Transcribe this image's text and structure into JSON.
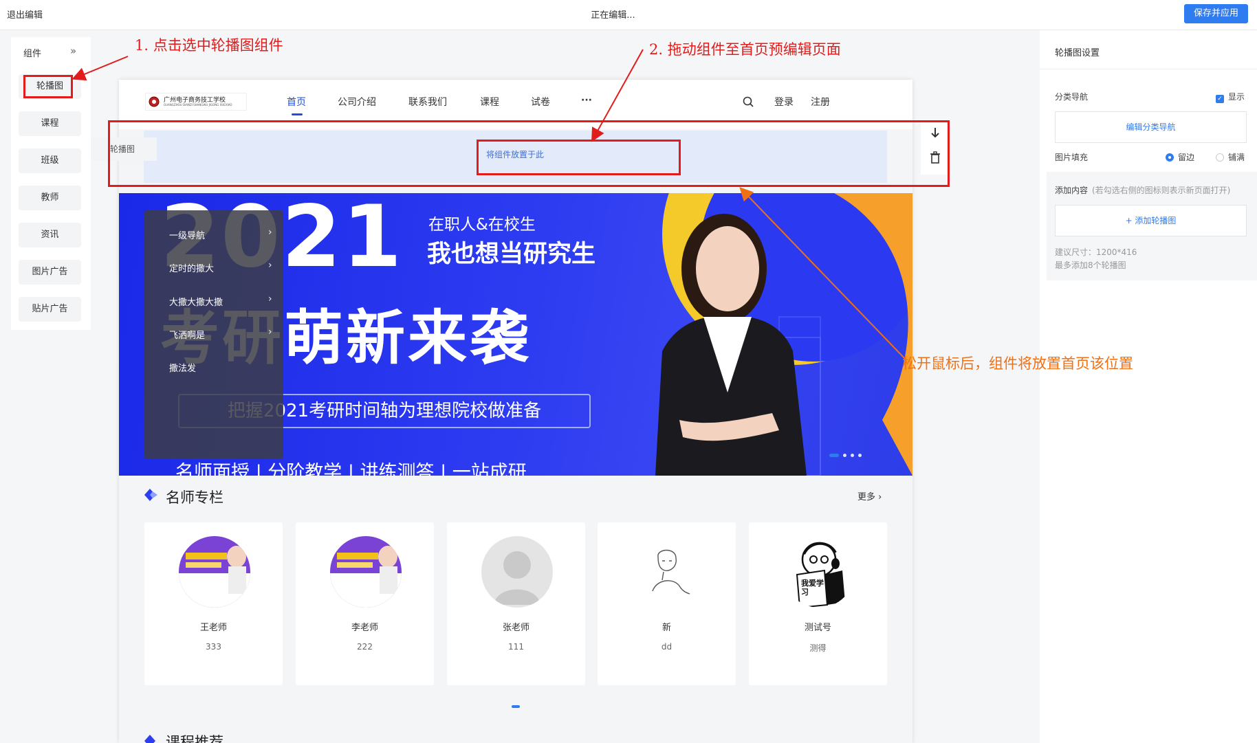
{
  "topbar": {
    "exit_label": "退出编辑",
    "status": "正在编辑...",
    "save_label": "保存并应用"
  },
  "left_panel": {
    "title": "组件",
    "items": [
      "轮播图",
      "课程",
      "班级",
      "教师",
      "资讯",
      "图片广告",
      "贴片广告"
    ]
  },
  "annotations": {
    "step1": "1. 点击选中轮播图组件",
    "step2": "2. 拖动组件至首页预编辑页面",
    "step3": "松开鼠标后，组件将放置首页该位置"
  },
  "site": {
    "logo_text": "广州电子商务技工学校",
    "logo_sub": "GUANGZHOU DIANZI SHANGWU JIGONG XUEXIAO",
    "nav": [
      "首页",
      "公司介绍",
      "联系我们",
      "课程",
      "试卷",
      "···"
    ],
    "login": "登录",
    "register": "注册",
    "drag_ghost": "轮播图",
    "drop_hint": "将组件放置于此"
  },
  "banner": {
    "year": "2021",
    "line1": "在职人&在校生",
    "line2": "我也想当研究生",
    "headline": "考研萌新来袭",
    "ribbon": "把握2021考研时间轴为理想院校做准备",
    "bottom": "名师面授 | 分阶教学 | 讲练测答 | 一站成研",
    "subnav": [
      "一级导航",
      "定时的撒大",
      "大撒大撒大撒",
      "飞洒啊是",
      "撒法发"
    ]
  },
  "teachers": {
    "title": "名师专栏",
    "more": "更多",
    "cards": [
      {
        "name": "王老师",
        "desc": "333",
        "avatar": "course-poster"
      },
      {
        "name": "李老师",
        "desc": "222",
        "avatar": "course-poster"
      },
      {
        "name": "张老师",
        "desc": "111",
        "avatar": "default-user"
      },
      {
        "name": "新",
        "desc": "dd",
        "avatar": "line-sketch"
      },
      {
        "name": "测试号",
        "desc": "测得",
        "avatar": "cartoon-sign"
      }
    ],
    "cartoon_sign": "我爱学习"
  },
  "next_section_title": "课程推荐",
  "right_panel": {
    "title": "轮播图设置",
    "category_nav": "分类导航",
    "show_label": "显示",
    "edit_category": "编辑分类导航",
    "fill_label": "图片填充",
    "fill_options": [
      "留边",
      "铺满"
    ],
    "fill_selected": "留边",
    "add_content": "添加内容",
    "add_hint": "(若勾选右侧的图标则表示新页面打开)",
    "add_button": "+ 添加轮播图",
    "size_hint": "建议尺寸：1200*416",
    "max_hint": "最多添加8个轮播图"
  },
  "colors": {
    "accent": "#2f7bf0",
    "nav_active": "#1f4de0",
    "annotation_red": "#e21b1b",
    "annotation_orange": "#f07016",
    "banner_blue": "#2b39f0"
  }
}
